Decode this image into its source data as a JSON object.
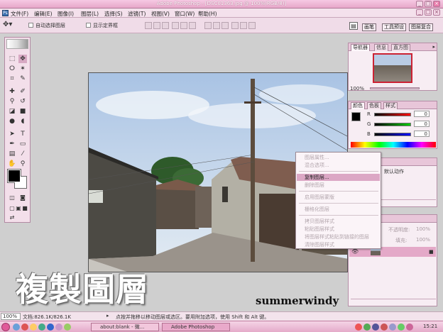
{
  "window": {
    "title": "Adobe Photoshop - [DSC01363.jpg @ 100%(RGB/8)]",
    "controls": [
      "_",
      "□",
      "×"
    ]
  },
  "menubar": {
    "items": [
      "文件(F)",
      "编辑(E)",
      "图像(I)",
      "图层(L)",
      "选择(S)",
      "滤镜(T)",
      "视图(V)",
      "窗口(W)",
      "帮助(H)"
    ],
    "doc_controls": [
      "_",
      "□",
      "×"
    ]
  },
  "options": {
    "auto_select_label": "自动选择图层",
    "show_bounds_label": "显示定界框",
    "palette_well_tabs": [
      "画笔",
      "工具预设",
      "图层复合"
    ]
  },
  "navigator": {
    "tabs": [
      "导航器",
      "信息",
      "直方图"
    ],
    "zoom": "100%"
  },
  "color": {
    "tabs": [
      "颜色",
      "色板",
      "样式"
    ],
    "channels": [
      {
        "label": "R",
        "value": "0",
        "color": "#cc0000"
      },
      {
        "label": "G",
        "value": "0",
        "color": "#00a000"
      },
      {
        "label": "B",
        "value": "0",
        "color": "#0000cc"
      }
    ]
  },
  "actions": {
    "tab": "动作",
    "item": "默认动作"
  },
  "layers": {
    "tab": "路径",
    "opacity_label": "不透明度:",
    "opacity": "100%",
    "fill_label": "填充:",
    "fill": "100%"
  },
  "context_menu": {
    "items": [
      {
        "label": "图层属性...",
        "enabled": false
      },
      {
        "label": "混合选项...",
        "enabled": false
      },
      {
        "sep": true
      },
      {
        "label": "复制图层...",
        "enabled": true,
        "highlight": true
      },
      {
        "label": "删除图层",
        "enabled": false
      },
      {
        "sep": true
      },
      {
        "label": "启用图层蒙版",
        "enabled": false
      },
      {
        "sep": true
      },
      {
        "label": "栅格化图层",
        "enabled": false
      },
      {
        "sep": true
      },
      {
        "label": "拷贝图层样式",
        "enabled": false
      },
      {
        "label": "粘贴图层样式",
        "enabled": false
      },
      {
        "label": "将图层样式粘贴到链接的图层",
        "enabled": false
      },
      {
        "label": "清除图层样式",
        "enabled": false
      }
    ]
  },
  "status": {
    "zoom": "100%",
    "doc_label": "文档:826.1K/826.1K",
    "hint": "点按并拖移以移动图层或选区。要用附加选项，使用 Shift 和 Alt 键。"
  },
  "taskbar": {
    "tasks": [
      "about:blank - 微...",
      "Adobe Photoshop"
    ],
    "clock": "15:21"
  },
  "overlay": {
    "big_text": "複製圖層",
    "signature": "summerwindy"
  },
  "colors": {
    "accent": "#e7a7c9",
    "panel_bg": "#f7edf3",
    "workspace": "#cfcfcf",
    "highlight": "#dca7c5"
  }
}
